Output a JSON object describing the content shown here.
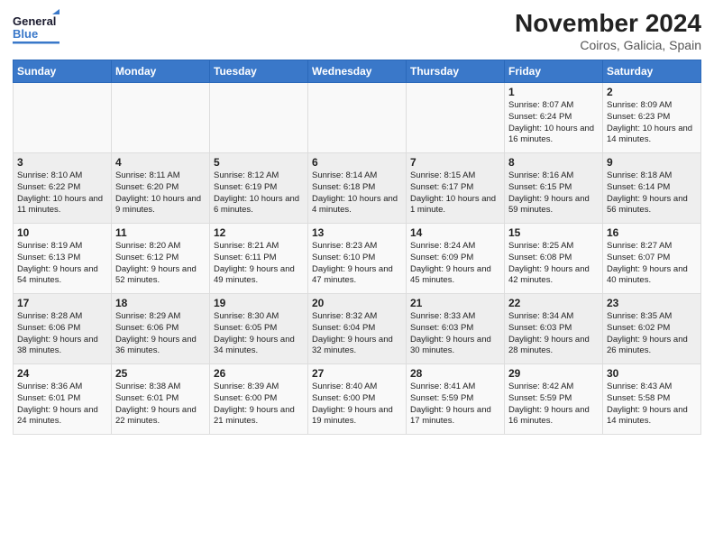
{
  "logo": {
    "line1": "General",
    "line2": "Blue"
  },
  "title": "November 2024",
  "subtitle": "Coiros, Galicia, Spain",
  "days_of_week": [
    "Sunday",
    "Monday",
    "Tuesday",
    "Wednesday",
    "Thursday",
    "Friday",
    "Saturday"
  ],
  "weeks": [
    [
      {
        "day": "",
        "content": ""
      },
      {
        "day": "",
        "content": ""
      },
      {
        "day": "",
        "content": ""
      },
      {
        "day": "",
        "content": ""
      },
      {
        "day": "",
        "content": ""
      },
      {
        "day": "1",
        "content": "Sunrise: 8:07 AM\nSunset: 6:24 PM\nDaylight: 10 hours and 16 minutes."
      },
      {
        "day": "2",
        "content": "Sunrise: 8:09 AM\nSunset: 6:23 PM\nDaylight: 10 hours and 14 minutes."
      }
    ],
    [
      {
        "day": "3",
        "content": "Sunrise: 8:10 AM\nSunset: 6:22 PM\nDaylight: 10 hours and 11 minutes."
      },
      {
        "day": "4",
        "content": "Sunrise: 8:11 AM\nSunset: 6:20 PM\nDaylight: 10 hours and 9 minutes."
      },
      {
        "day": "5",
        "content": "Sunrise: 8:12 AM\nSunset: 6:19 PM\nDaylight: 10 hours and 6 minutes."
      },
      {
        "day": "6",
        "content": "Sunrise: 8:14 AM\nSunset: 6:18 PM\nDaylight: 10 hours and 4 minutes."
      },
      {
        "day": "7",
        "content": "Sunrise: 8:15 AM\nSunset: 6:17 PM\nDaylight: 10 hours and 1 minute."
      },
      {
        "day": "8",
        "content": "Sunrise: 8:16 AM\nSunset: 6:15 PM\nDaylight: 9 hours and 59 minutes."
      },
      {
        "day": "9",
        "content": "Sunrise: 8:18 AM\nSunset: 6:14 PM\nDaylight: 9 hours and 56 minutes."
      }
    ],
    [
      {
        "day": "10",
        "content": "Sunrise: 8:19 AM\nSunset: 6:13 PM\nDaylight: 9 hours and 54 minutes."
      },
      {
        "day": "11",
        "content": "Sunrise: 8:20 AM\nSunset: 6:12 PM\nDaylight: 9 hours and 52 minutes."
      },
      {
        "day": "12",
        "content": "Sunrise: 8:21 AM\nSunset: 6:11 PM\nDaylight: 9 hours and 49 minutes."
      },
      {
        "day": "13",
        "content": "Sunrise: 8:23 AM\nSunset: 6:10 PM\nDaylight: 9 hours and 47 minutes."
      },
      {
        "day": "14",
        "content": "Sunrise: 8:24 AM\nSunset: 6:09 PM\nDaylight: 9 hours and 45 minutes."
      },
      {
        "day": "15",
        "content": "Sunrise: 8:25 AM\nSunset: 6:08 PM\nDaylight: 9 hours and 42 minutes."
      },
      {
        "day": "16",
        "content": "Sunrise: 8:27 AM\nSunset: 6:07 PM\nDaylight: 9 hours and 40 minutes."
      }
    ],
    [
      {
        "day": "17",
        "content": "Sunrise: 8:28 AM\nSunset: 6:06 PM\nDaylight: 9 hours and 38 minutes."
      },
      {
        "day": "18",
        "content": "Sunrise: 8:29 AM\nSunset: 6:06 PM\nDaylight: 9 hours and 36 minutes."
      },
      {
        "day": "19",
        "content": "Sunrise: 8:30 AM\nSunset: 6:05 PM\nDaylight: 9 hours and 34 minutes."
      },
      {
        "day": "20",
        "content": "Sunrise: 8:32 AM\nSunset: 6:04 PM\nDaylight: 9 hours and 32 minutes."
      },
      {
        "day": "21",
        "content": "Sunrise: 8:33 AM\nSunset: 6:03 PM\nDaylight: 9 hours and 30 minutes."
      },
      {
        "day": "22",
        "content": "Sunrise: 8:34 AM\nSunset: 6:03 PM\nDaylight: 9 hours and 28 minutes."
      },
      {
        "day": "23",
        "content": "Sunrise: 8:35 AM\nSunset: 6:02 PM\nDaylight: 9 hours and 26 minutes."
      }
    ],
    [
      {
        "day": "24",
        "content": "Sunrise: 8:36 AM\nSunset: 6:01 PM\nDaylight: 9 hours and 24 minutes."
      },
      {
        "day": "25",
        "content": "Sunrise: 8:38 AM\nSunset: 6:01 PM\nDaylight: 9 hours and 22 minutes."
      },
      {
        "day": "26",
        "content": "Sunrise: 8:39 AM\nSunset: 6:00 PM\nDaylight: 9 hours and 21 minutes."
      },
      {
        "day": "27",
        "content": "Sunrise: 8:40 AM\nSunset: 6:00 PM\nDaylight: 9 hours and 19 minutes."
      },
      {
        "day": "28",
        "content": "Sunrise: 8:41 AM\nSunset: 5:59 PM\nDaylight: 9 hours and 17 minutes."
      },
      {
        "day": "29",
        "content": "Sunrise: 8:42 AM\nSunset: 5:59 PM\nDaylight: 9 hours and 16 minutes."
      },
      {
        "day": "30",
        "content": "Sunrise: 8:43 AM\nSunset: 5:58 PM\nDaylight: 9 hours and 14 minutes."
      }
    ]
  ]
}
